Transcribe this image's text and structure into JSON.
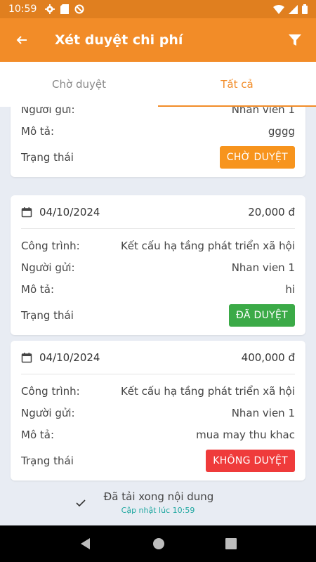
{
  "status_bar": {
    "time": "10:59"
  },
  "app_bar": {
    "title": "Xét duyệt chi phí",
    "back_icon": "arrow-left-icon",
    "filter_icon": "filter-icon"
  },
  "tabs": [
    {
      "label": "Chờ duyệt",
      "active": false
    },
    {
      "label": "Tất cả",
      "active": true
    }
  ],
  "labels": {
    "cong_trinh": "Công trình:",
    "nguoi_gui": "Người gửi:",
    "mo_ta": "Mô tả:",
    "trang_thai": "Trạng thái"
  },
  "cards": [
    {
      "partial_row_label": "Người gửi:",
      "partial_row_value": "Nhan vien 1",
      "description": "gggg",
      "status": "CHỜ DUYỆT",
      "status_color": "#F7941D"
    },
    {
      "date": "04/10/2024",
      "amount": "20,000 đ",
      "project": "Kết cấu hạ tầng phát triển xã hội",
      "sender": "Nhan vien 1",
      "description": "hi",
      "status": "ĐÃ DUYỆT",
      "status_color": "#3BAA47"
    },
    {
      "date": "04/10/2024",
      "amount": "400,000 đ",
      "project": "Kết cấu hạ tầng phát triển xã hội",
      "sender": "Nhan vien 1",
      "description": "mua may thu khac",
      "status": "KHÔNG DUYỆT",
      "status_color": "#EF3B3B"
    }
  ],
  "footer": {
    "loaded_message": "Đã tải xong nội dung",
    "updated_at": "Cập nhật lúc 10:59"
  },
  "colors": {
    "primary": "#F28C28",
    "status_bar": "#E07F1F",
    "background": "#E8ECF3"
  }
}
